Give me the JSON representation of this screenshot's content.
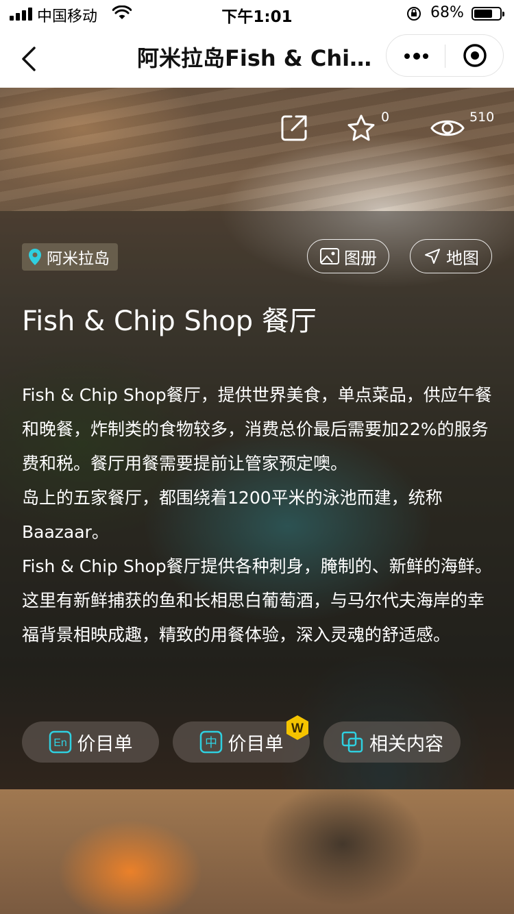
{
  "status_bar": {
    "carrier": "中国移动",
    "time": "下午1:01",
    "battery_percent": "68%",
    "battery_level": 0.68
  },
  "nav": {
    "title": "阿米拉岛Fish & Chip Shop 餐厅"
  },
  "actions": {
    "favorite_count": "0",
    "view_count": "510"
  },
  "location": {
    "label": "阿米拉岛"
  },
  "buttons": {
    "album": "图册",
    "map": "地图"
  },
  "heading": "Fish & Chip Shop 餐厅",
  "description": [
    "Fish & Chip Shop餐厅，提供世界美食，单点菜品，供应午餐和晚餐，炸制类的食物较多，消费总价最后需要加22%的服务费和税。餐厅用餐需要提前让管家预定噢。",
    "岛上的五家餐厅，都围绕着1200平米的泳池而建，统称Baazaar。",
    "Fish & Chip Shop餐厅提供各种刺身，腌制的、新鲜的海鲜。这里有新鲜捕获的鱼和长相思白葡萄酒，与马尔代夫海岸的幸福背景相映成趣，精致的用餐体验，深入灵魂的舒适感。"
  ],
  "pills": {
    "en_menu": "价目单",
    "zh_menu": "价目单",
    "en_icon_text": "En",
    "zh_icon_text": "中",
    "related": "相关内容",
    "badge": "W"
  },
  "colors": {
    "accent_teal": "#2fd0e0",
    "badge_gold": "#f5c400"
  }
}
